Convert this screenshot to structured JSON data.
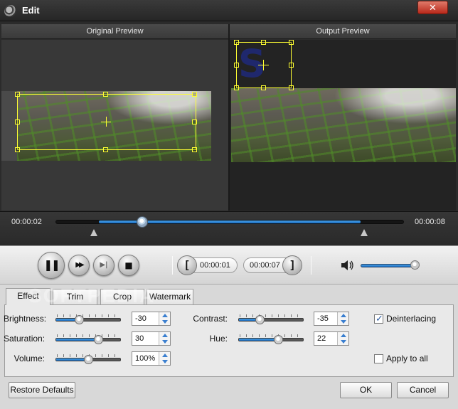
{
  "window": {
    "title": "Edit",
    "close_glyph": "✕"
  },
  "preview": {
    "original_label": "Original Preview",
    "output_label": "Output Preview",
    "watermark_glyph": "S"
  },
  "timeline": {
    "current_time": "00:00:02",
    "end_time": "00:00:08",
    "progress": 0.25
  },
  "controls": {
    "pause_glyph": "❚❚",
    "forward_glyph": "▶▶",
    "step_glyph": "▶|",
    "stop_glyph": "■",
    "start_time": "00:00:01",
    "end_time": "00:00:07",
    "left_bracket": "[",
    "right_bracket": "]",
    "volume_level": 0.9
  },
  "tabs": [
    {
      "label": "Effect",
      "active": true
    },
    {
      "label": "Trim",
      "active": false
    },
    {
      "label": "Crop",
      "active": false
    },
    {
      "label": "Watermark",
      "active": false
    }
  ],
  "effect": {
    "brightness": {
      "label": "Brightness:",
      "value": "-30"
    },
    "saturation": {
      "label": "Saturation:",
      "value": "30"
    },
    "volume": {
      "label": "Volume:",
      "value": "100%"
    },
    "contrast": {
      "label": "Contrast:",
      "value": "-35"
    },
    "hue": {
      "label": "Hue:",
      "value": "22"
    },
    "deinterlacing": {
      "label": "Deinterlacing",
      "checked": true
    },
    "apply_to_all": {
      "label": "Apply to all",
      "checked": false
    }
  },
  "footer": {
    "restore_label": "Restore Defaults",
    "ok_label": "OK",
    "cancel_label": "Cancel"
  },
  "overlay_watermark": "SOFTPEDIA",
  "colors": {
    "accent": "#1a6cc0",
    "selection": "#ffff33",
    "close": "#c0392b"
  },
  "icons": [
    "app-logo-icon",
    "close-icon",
    "pause-icon",
    "fast-forward-icon",
    "step-icon",
    "stop-icon",
    "volume-icon"
  ]
}
